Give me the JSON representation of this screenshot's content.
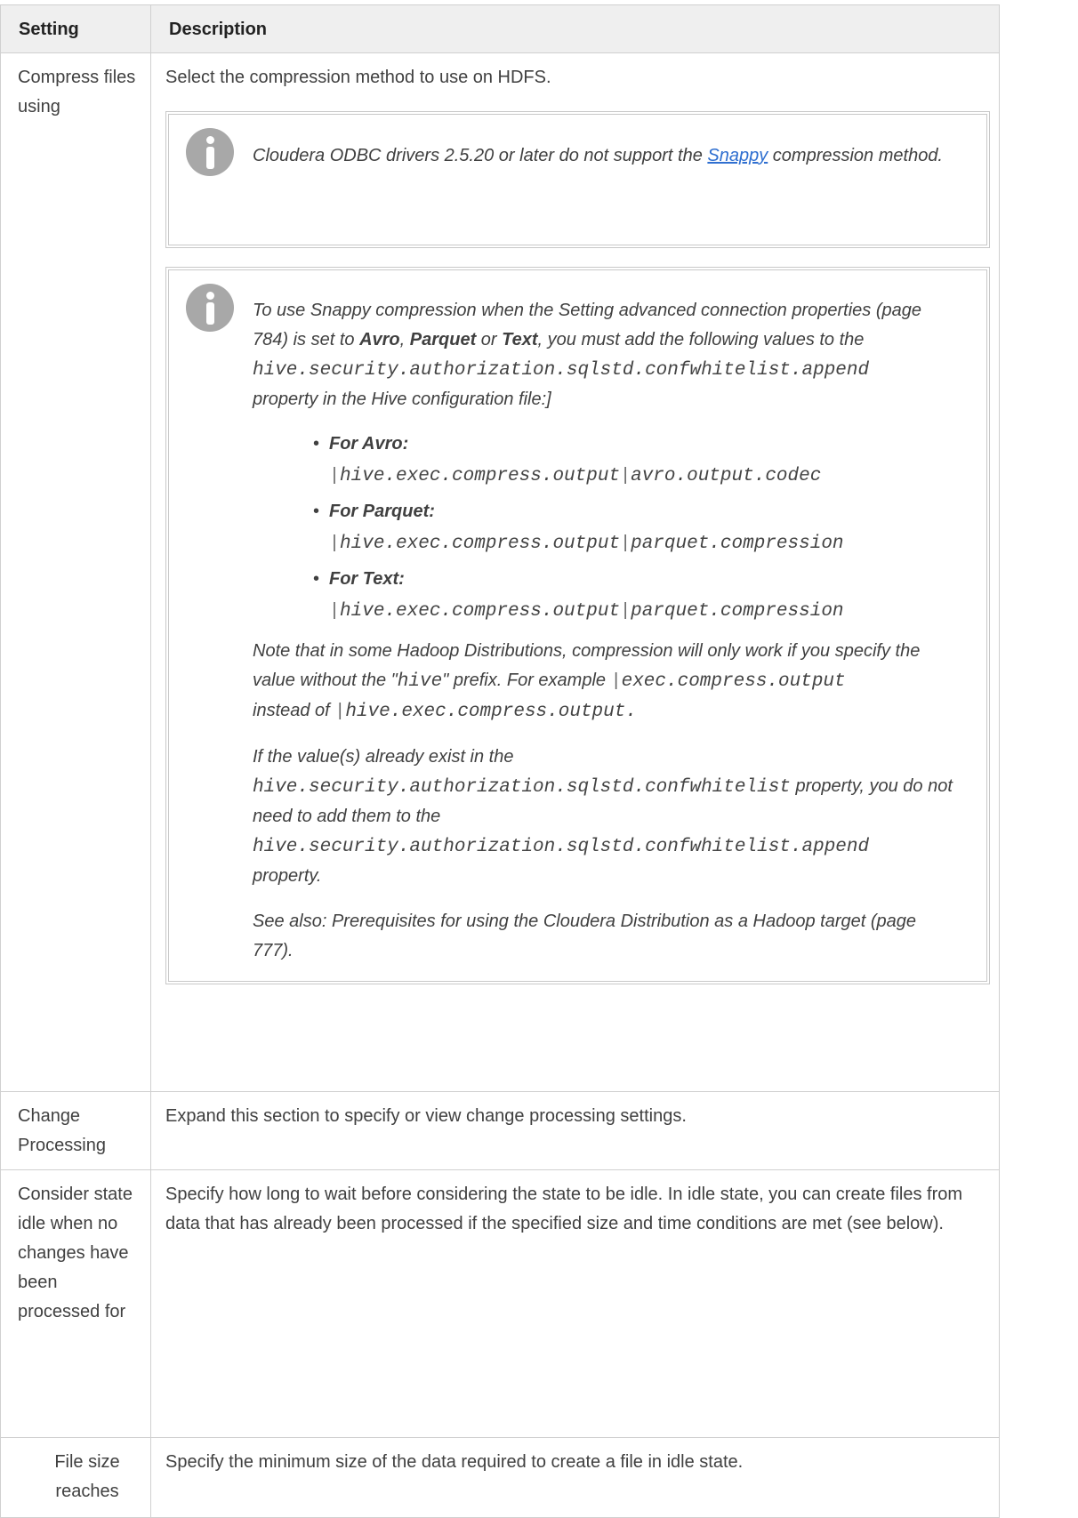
{
  "table": {
    "headers": {
      "setting": "Setting",
      "description": "Description"
    },
    "rows": {
      "compress": {
        "setting": "Compress files using",
        "description": "Select the compression method to use on HDFS.",
        "note1": {
          "before_link": "Cloudera ODBC drivers 2.5.20 or later do not support the ",
          "link": "Snappy",
          "after_link": " compression method."
        },
        "note2": {
          "intro_a": "To use Snappy compression when the Setting advanced connection properties (page 784) is set to ",
          "avro": "Avro",
          "comma": ", ",
          "parquet": "Parquet",
          "or": " or ",
          "text": "Text",
          "intro_b": ", you must add the following values to the",
          "prop_append": "hive.security.authorization.sqlstd.confwhitelist.append",
          "intro_c": "property in the Hive configuration file:]",
          "bullets": [
            {
              "label": "For Avro:",
              "pipe1": "|",
              "val1": "hive.exec.compress.output",
              "pipe2": "|",
              "val2": "avro.output.codec"
            },
            {
              "label": "For Parquet:",
              "pipe1": "|",
              "val1": "hive.exec.compress.output",
              "pipe2": "|",
              "val2": "parquet.compression"
            },
            {
              "label": "For Text:",
              "pipe1": "|",
              "val1": "hive.exec.compress.output",
              "pipe2": "|",
              "val2": "parquet.compression"
            }
          ],
          "hadoop_a": "Note that in some Hadoop Distributions, compression will only work if you specify the value without the \"",
          "hive_word": "hive",
          "hadoop_b": "\" prefix. For example ",
          "ex_pipe": "|",
          "ex_val": "exec.compress.output",
          "hadoop_c": "instead of ",
          "ex2_pipe": "|",
          "ex2_val": "hive.exec.compress.output.",
          "exist_a": "If the value(s) already exist in the",
          "prop_whitelist": "hive.security.authorization.sqlstd.confwhitelist",
          "exist_b": " property, you do not need to add them to the",
          "prop_append2": "hive.security.authorization.sqlstd.confwhitelist.append",
          "exist_c": "property.",
          "see_also": "See also: Prerequisites for using the Cloudera Distribution as a Hadoop target (page 777)."
        }
      },
      "change": {
        "setting": "Change Processing",
        "description": "Expand this section to specify or view change processing settings."
      },
      "idle": {
        "setting": "Consider state idle when no changes have been processed for",
        "description": "Specify how long to wait before considering the state to be idle. In idle state, you can create files from data that has already been processed if the specified size and time conditions are met (see below)."
      },
      "filesize": {
        "setting": "File size reaches",
        "description": "Specify the minimum size of the data required to create a file in idle state."
      }
    }
  },
  "icons": {
    "note_icon": "info-icon"
  },
  "colors": {
    "header_bg": "#efefef",
    "border": "#d0d0d0",
    "link": "#2f6fd0",
    "icon": "#a8a8a8"
  }
}
